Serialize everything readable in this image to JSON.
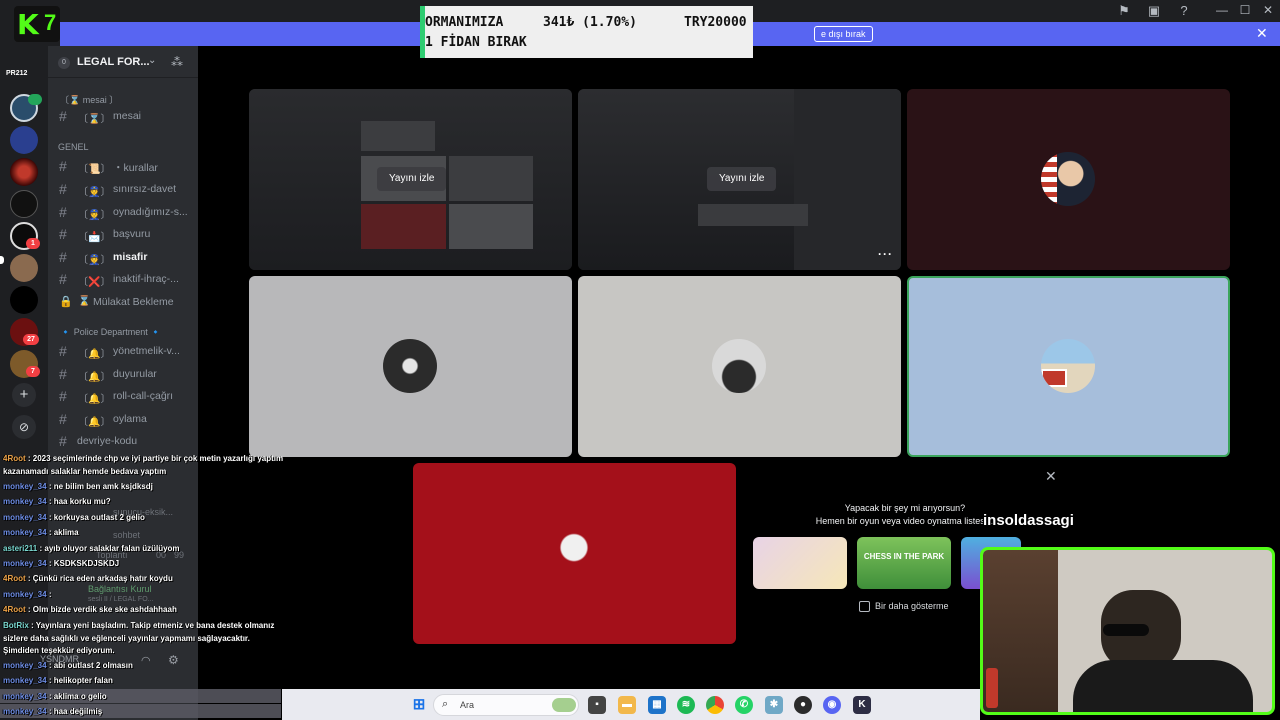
{
  "ticker": {
    "line1_left": "ORMANIMIZA",
    "line1_mid": "341₺ (1.70%)",
    "line1_right": "TRY20000",
    "line2": "1 FİDAN BIRAK"
  },
  "kick_logo": {
    "letter": "K",
    "number": "7"
  },
  "banner": {
    "button_label": "e dışı bırak",
    "close": "✕"
  },
  "rail": {
    "top_label": "PR212",
    "badges": [
      "1",
      "27",
      "7"
    ]
  },
  "server": {
    "name": "LEGAL FOR...",
    "level": "0"
  },
  "sidebar": {
    "categories": {
      "mesai": "〔⌛ mesai 〕",
      "genel": "GENEL",
      "police": "🔹 Police Department 🔹"
    },
    "channels": [
      {
        "emoji": "〔⌛〕",
        "name": "mesai"
      },
      {
        "emoji": "〔📜〕",
        "name": "・kurallar"
      },
      {
        "emoji": "〔👮〕",
        "name": "sınırsız-davet"
      },
      {
        "emoji": "〔👮〕",
        "name": "oynadığımız-s..."
      },
      {
        "emoji": "〔📩〕",
        "name": "başvuru"
      },
      {
        "emoji": "〔👮〕",
        "name": "misafir"
      },
      {
        "emoji": "〔❌〕",
        "name": "inaktif-ihraç-..."
      },
      {
        "emoji": "⌛",
        "name": "Mülakat Bekleme"
      },
      {
        "emoji": "〔🔔〕",
        "name": "yönetmelik-v..."
      },
      {
        "emoji": "〔🔔〕",
        "name": "duyurular"
      },
      {
        "emoji": "〔🔔〕",
        "name": "roll-call-çağrı"
      },
      {
        "emoji": "〔🔔〕",
        "name": "oylama"
      },
      {
        "emoji": "",
        "name": "devriye-kodu"
      }
    ]
  },
  "stage": {
    "watch_label": "Yayını izle",
    "more_label": "···"
  },
  "activity": {
    "title": "Yapacak bir şey mi arıyorsun?",
    "subtitle": "Hemen bir oyun veya video oynatma listesi b",
    "games": [
      "",
      "CHESS IN THE PARK",
      ""
    ],
    "dont_show": "Bir daha gösterme"
  },
  "streamer_name": "insoldassagi",
  "chat": [
    {
      "user": "4Root",
      "text": " : 2023 seçimlerinde chp ve iyi partiye bir çok metin yazarlığı yaptım"
    },
    {
      "user": "",
      "text": "kazanamadı salaklar hemde bedava yaptım"
    },
    {
      "user": "monkey_34",
      "text": " : ne bilim ben amk ksjdksdj"
    },
    {
      "user": "monkey_34",
      "text": " : haa korku mu?"
    },
    {
      "user": "monkey_34",
      "text": " : korkuysa outlast 2 gelio"
    },
    {
      "user": "monkey_34",
      "text": " : aklima"
    },
    {
      "user": "asteri211",
      "text": " : ayıb oluyor salaklar falan üzülüyom"
    },
    {
      "user": "monkey_34",
      "text": " : KSDKSKDJSKDJ"
    },
    {
      "user": "4Root",
      "text": " : Çünkü rica eden arkadaş hatır koydu"
    },
    {
      "user": "monkey_34",
      "text": " : "
    },
    {
      "user": "4Root",
      "text": " : Olm bizde verdik ske ske ashdahhaah"
    },
    {
      "user": "BotRix",
      "text": " : Yayınlara yeni başladım. Takip etmeniz ve bana destek olmanız sizlere daha sağlıklı ve eğlenceli yayınlar yapmamı sağlayacaktır. Şimdiden teşekkür ediyorum."
    },
    {
      "user": "monkey_34",
      "text": " : abi outlast 2 olmasın"
    },
    {
      "user": "monkey_34",
      "text": " : helikopter falan"
    },
    {
      "user": "monkey_34",
      "text": " : aklima o gelio"
    },
    {
      "user": "monkey_34",
      "text": " : haa değilmiş"
    }
  ],
  "ghost": {
    "channel1": "sunucu-eksik...",
    "channel2": "sohbet",
    "voice_channel": "Toplantı",
    "connection": "Bağlantısı Kurul",
    "connection_sub": "sesli II / LEGAL FO...",
    "username": "YSNDMR",
    "count": "00",
    "count2": "99"
  },
  "taskbar": {
    "search_placeholder": "Ara"
  },
  "colors": {
    "discord_blurple": "#5865f2",
    "kick_green": "#53fc18",
    "speaking_border": "#3ba55c"
  }
}
